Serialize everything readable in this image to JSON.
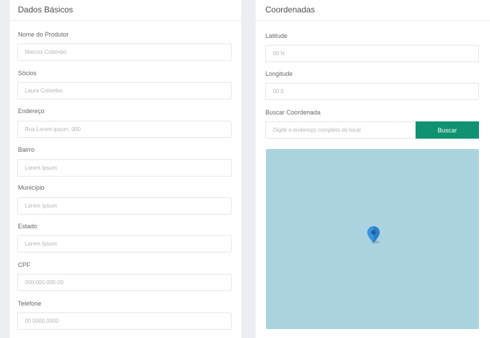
{
  "basic": {
    "title": "Dados Básicos",
    "fields": [
      {
        "label": "Nome do Produtor",
        "placeholder": "Marcos Colombo"
      },
      {
        "label": "Sócios",
        "placeholder": "Laura Colombo"
      },
      {
        "label": "Endereço",
        "placeholder": "Rua Lorem ipsum, 000"
      },
      {
        "label": "Bairro",
        "placeholder": "Lorem Ipsum"
      },
      {
        "label": "Município",
        "placeholder": "Lorem Ipsum"
      },
      {
        "label": "Estado",
        "placeholder": "Lorem Ipsum"
      },
      {
        "label": "CPF",
        "placeholder": "000.000.000-00"
      },
      {
        "label": "Telefone",
        "placeholder": "00 0000.0000"
      }
    ]
  },
  "coords": {
    "title": "Coordenadas",
    "latitude": {
      "label": "Latitude",
      "placeholder": "00 N"
    },
    "longitude": {
      "label": "Longitude",
      "placeholder": "00 E"
    },
    "search": {
      "label": "Buscar Coordenada",
      "placeholder": "Digite o endereço completo do local",
      "button_label": "Buscar"
    }
  },
  "icons": {
    "map_pin": "map-pin-icon"
  },
  "colors": {
    "accent": "#0e9270",
    "map_water": "#aad3df",
    "pin": "#2a7fc9"
  }
}
